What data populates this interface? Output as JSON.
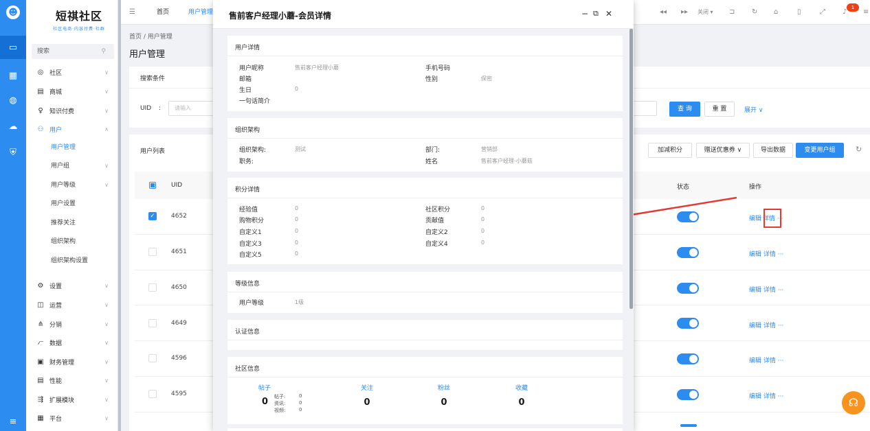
{
  "logo": {
    "main": "短祺社区",
    "sub": "社区电商·内容付费·社群"
  },
  "sidebar": {
    "search_placeholder": "搜索",
    "menu": [
      {
        "label": "社区",
        "icon": "chat-icon"
      },
      {
        "label": "商城",
        "icon": "shop-icon"
      },
      {
        "label": "知识付费",
        "icon": "bulb-icon"
      },
      {
        "label": "用户",
        "icon": "user-icon"
      }
    ],
    "user_sub": [
      "用户管理",
      "用户组",
      "用户等级",
      "用户设置",
      "推荐关注",
      "组织架构",
      "组织架构设置"
    ],
    "menu2": [
      {
        "label": "设置",
        "icon": "gear-icon"
      },
      {
        "label": "运营",
        "icon": "operate-icon"
      },
      {
        "label": "分销",
        "icon": "share-icon"
      },
      {
        "label": "数据",
        "icon": "chart-icon"
      },
      {
        "label": "财务管理",
        "icon": "finance-icon"
      },
      {
        "label": "性能",
        "icon": "perf-icon"
      },
      {
        "label": "扩展模块",
        "icon": "extend-icon"
      },
      {
        "label": "平台",
        "icon": "platform-icon"
      }
    ]
  },
  "topbar": {
    "tabs": [
      "首页",
      "用户管理"
    ],
    "close_label": "关闭",
    "notify_count": "1"
  },
  "page": {
    "breadcrumb": [
      "首页",
      "用户管理"
    ],
    "title": "用户管理",
    "search_title": "搜索条件",
    "uid_label": "UID",
    "uid_colon": ":",
    "uid_placeholder": "请输入",
    "query": "查 询",
    "reset": "重 置",
    "expand": "展开",
    "list_title": "用户列表",
    "buttons": [
      "加减积分",
      "赠送优惠券",
      "导出数据",
      "变更用户组"
    ],
    "col_uid": "UID",
    "col_status": "状态",
    "col_action": "操作",
    "rows": [
      {
        "uid": "4652",
        "checked": true
      },
      {
        "uid": "4651",
        "checked": false
      },
      {
        "uid": "4650",
        "checked": false
      },
      {
        "uid": "4649",
        "checked": false
      },
      {
        "uid": "4596",
        "checked": false
      },
      {
        "uid": "4595",
        "checked": false
      }
    ],
    "edit": "编辑",
    "detail": "详情",
    "more": "···"
  },
  "modal": {
    "title": "售前客户经理小蘑-会员详情",
    "user_detail": {
      "title": "用户详情",
      "nickname_label": "用户昵称",
      "nickname": "售前客户经理小蘑",
      "phone_label": "手机号码",
      "phone": "",
      "email_label": "邮箱",
      "email": "",
      "gender_label": "性别",
      "gender": "保密",
      "birthday_label": "生日",
      "birthday": "0",
      "intro_label": "一句话简介",
      "intro": ""
    },
    "org": {
      "title": "组织架构",
      "org_label": "组织架构:",
      "org": "测试",
      "dept_label": "部门:",
      "dept": "营销部",
      "job_label": "职务:",
      "job": "",
      "name_label": "姓名",
      "name": "售前客户经理-小蘑菇"
    },
    "points": {
      "title": "积分详情",
      "items": [
        {
          "label": "经验值",
          "value": "0"
        },
        {
          "label": "社区积分",
          "value": "0"
        },
        {
          "label": "购物积分",
          "value": "0"
        },
        {
          "label": "贡献值",
          "value": "0"
        },
        {
          "label": "自定义1",
          "value": "0"
        },
        {
          "label": "自定义2",
          "value": "0"
        },
        {
          "label": "自定义3",
          "value": "0"
        },
        {
          "label": "自定义4",
          "value": "0"
        },
        {
          "label": "自定义5",
          "value": "0"
        }
      ]
    },
    "level": {
      "title": "等级信息",
      "label": "用户等级",
      "value": "1级"
    },
    "auth": {
      "title": "认证信息"
    },
    "community": {
      "title": "社区信息",
      "posts_label": "帖子",
      "posts": "0",
      "post_breakdown": [
        {
          "label": "帖子:",
          "value": "0"
        },
        {
          "label": "资讯:",
          "value": "0"
        },
        {
          "label": "视频:",
          "value": "0"
        }
      ],
      "follow_label": "关注",
      "follow": "0",
      "fans_label": "粉丝",
      "fans": "0",
      "collect_label": "收藏",
      "collect": "0"
    }
  },
  "colors": {
    "primary": "#2d8cf0",
    "arrow": "#e53935",
    "highlight": "#e53935"
  }
}
